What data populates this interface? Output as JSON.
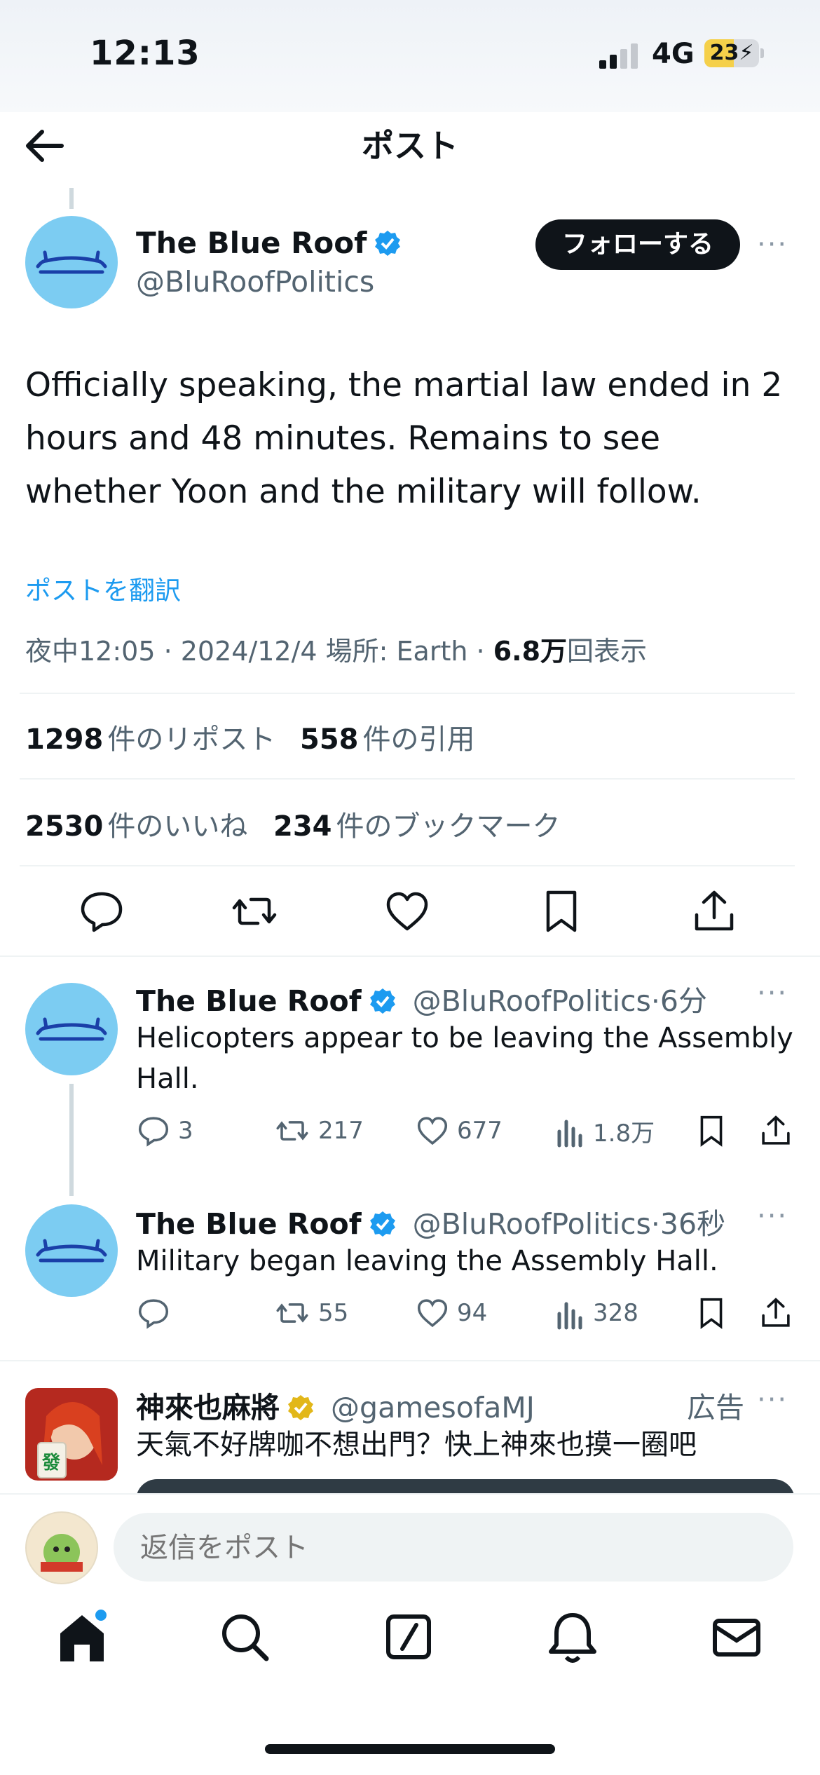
{
  "status_bar": {
    "time": "12:13",
    "network": "4G",
    "battery": "23"
  },
  "header": {
    "title": "ポスト"
  },
  "post": {
    "author_name": "The Blue Roof",
    "author_handle": "@BluRoofPolitics",
    "follow_label": "フォローする",
    "more": "···",
    "text": "Officially speaking, the martial law ended in 2 hours and 48 minutes. Remains to see whether Yoon and the military will follow.",
    "translate": "ポストを翻訳",
    "meta_prefix": "夜中12:05 · 2024/12/4 場所: Earth · ",
    "views_value": "6.8万",
    "views_label": "回表示",
    "reposts_value": "1298",
    "reposts_label": "件のリポスト",
    "quotes_value": "558",
    "quotes_label": "件の引用",
    "likes_value": "2530",
    "likes_label": "件のいいね",
    "bookmarks_value": "234",
    "bookmarks_label": "件のブックマーク"
  },
  "replies": [
    {
      "name": "The Blue Roof",
      "handle": "@BluRoofPolitics",
      "time": "·6分",
      "text": "Helicopters appear to be leaving the Assembly Hall.",
      "replies": "3",
      "reposts": "217",
      "likes": "677",
      "views": "1.8万"
    },
    {
      "name": "The Blue Roof",
      "handle": "@BluRoofPolitics",
      "time": "·36秒",
      "text": "Military began leaving the Assembly Hall.",
      "replies": "",
      "reposts": "55",
      "likes": "94",
      "views": "328"
    }
  ],
  "ad": {
    "name": "神來也麻將",
    "handle": "@gamesofaMJ",
    "ad_label": "広告",
    "text": "天氣不好牌咖不想出門？快上神來也摸一圈吧",
    "tile_char": "發"
  },
  "reply_bar": {
    "placeholder": "返信をポスト"
  },
  "colors": {
    "accent": "#1d9bf0",
    "avatar": "#7cccf2",
    "verified": "#1d9bf0",
    "gold_badge": "#e2b719"
  },
  "icons": [
    "back-arrow-icon",
    "verified-badge-icon",
    "reply-icon",
    "repost-icon",
    "like-icon",
    "bookmark-icon",
    "share-icon",
    "views-icon",
    "home-icon",
    "search-icon",
    "compose-icon",
    "bell-icon",
    "mail-icon"
  ]
}
